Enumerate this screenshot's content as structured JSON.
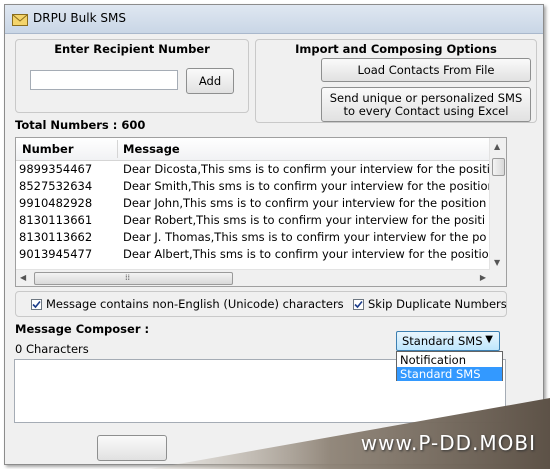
{
  "window": {
    "title": "DRPU Bulk SMS"
  },
  "recipient": {
    "heading": "Enter Recipient Number",
    "input_value": "",
    "add_label": "Add"
  },
  "import": {
    "heading": "Import and Composing Options",
    "load_label": "Load Contacts From File",
    "excel_line1": "Send unique or personalized SMS",
    "excel_line2": "to every Contact using Excel"
  },
  "total": {
    "label": "Total Numbers : 600"
  },
  "table": {
    "columns": [
      "Number",
      "Message"
    ],
    "rows": [
      {
        "number": "9899354467",
        "message": "Dear Dicosta,This sms is to confirm your interview for the positi"
      },
      {
        "number": "8527532634",
        "message": "Dear Smith,This sms is to confirm your interview for the position"
      },
      {
        "number": "9910482928",
        "message": "Dear John,This sms is to confirm your interview for the position"
      },
      {
        "number": "8130113661",
        "message": "Dear Robert,This sms is to confirm your interview for the positi"
      },
      {
        "number": "8130113662",
        "message": "Dear J. Thomas,This sms is to confirm your interview for the po"
      },
      {
        "number": "9013945477",
        "message": "Dear Albert,This sms is to confirm your interview for the positio"
      }
    ]
  },
  "options": {
    "unicode_label": "Message contains non-English (Unicode) characters",
    "unicode_checked": true,
    "skip_label": "Skip Duplicate Numbers",
    "skip_checked": true
  },
  "composer": {
    "heading": "Message Composer :",
    "char_count": "0 Characters",
    "text": "",
    "sms_type": {
      "selected": "Standard SMS",
      "options": [
        "Notification",
        "Standard SMS"
      ]
    }
  },
  "watermark": {
    "text": "www.P-DD.MOBI"
  },
  "colors": {
    "selection": "#3399ff",
    "titlebar": "#dfe7f1"
  }
}
